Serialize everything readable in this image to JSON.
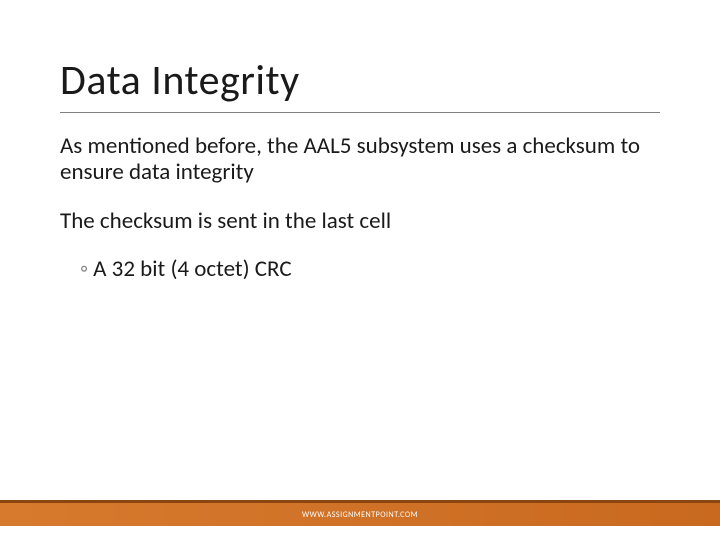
{
  "title": "Data Integrity",
  "paragraphs": {
    "p1": "As mentioned before, the AAL5 subsystem uses a checksum to ensure data integrity",
    "p2": "The checksum is sent in the last cell",
    "bullet1": "A 32 bit (4 octet) CRC"
  },
  "footer": "WWW.ASSIGNMENTPOINT.COM"
}
